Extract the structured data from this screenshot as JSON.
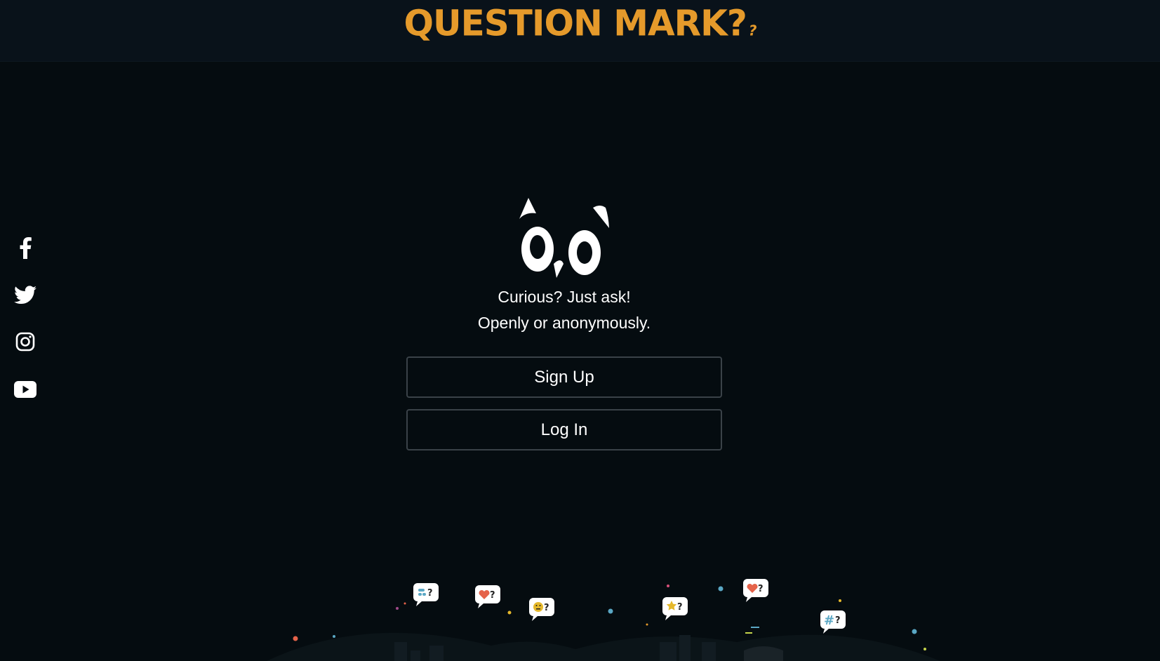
{
  "header": {
    "logo_text": "QUESTION MARK?",
    "logo_suffix": "?",
    "logo_color": "#e59a2b"
  },
  "social": [
    {
      "name": "facebook",
      "icon": "facebook-icon"
    },
    {
      "name": "twitter",
      "icon": "twitter-icon"
    },
    {
      "name": "instagram",
      "icon": "instagram-icon"
    },
    {
      "name": "youtube",
      "icon": "youtube-icon"
    }
  ],
  "hero": {
    "mascot_icon": "owl-eyes-icon",
    "tagline_line1": "Curious? Just ask!",
    "tagline_line2": "Openly or anonymously."
  },
  "actions": {
    "signup_label": "Sign Up",
    "login_label": "Log In"
  },
  "decor": {
    "bubbles": [
      "chat-bubble-icon",
      "heart-bubble-icon",
      "smiley-bubble-icon",
      "star-bubble-icon",
      "heart-bubble-icon",
      "hashtag-bubble-icon"
    ]
  },
  "colors": {
    "background": "#050c10",
    "topbar": "#09121a",
    "button_border": "#3a4248",
    "accent": "#e59a2b"
  }
}
